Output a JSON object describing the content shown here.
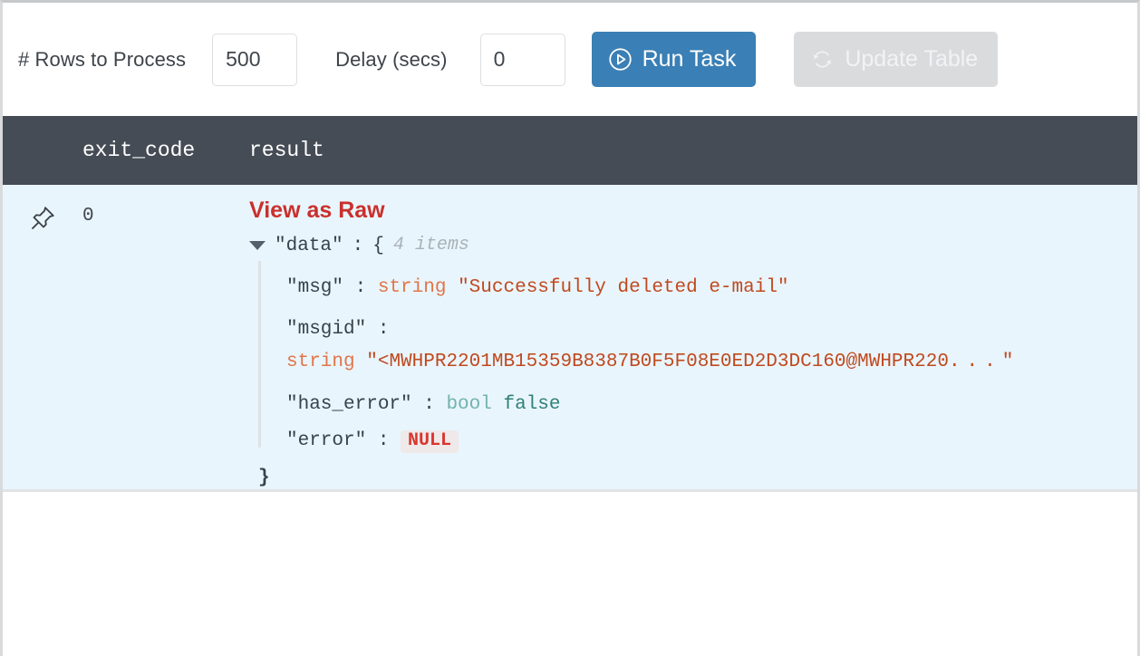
{
  "toolbar": {
    "rows_label": "# Rows to Process",
    "rows_value": "500",
    "rows_placeholder": "",
    "delay_label": "Delay (secs)",
    "delay_value": "0",
    "delay_placeholder": "",
    "run_button": "Run Task",
    "run_icon": "play-circle-icon",
    "update_button": "Update Table",
    "update_icon": "refresh-icon",
    "primary_color": "#3a7fb5",
    "disabled_color": "#d9dbdd"
  },
  "table": {
    "header_background": "#464c55",
    "row_background": "#e9f5fc",
    "columns": [
      {
        "key": "pin",
        "label": ""
      },
      {
        "key": "exit_code",
        "label": "exit_code"
      },
      {
        "key": "result",
        "label": "result"
      }
    ],
    "row": {
      "pin_icon": "pushpin-icon",
      "exit_code": "0",
      "raw_link": "View as Raw"
    }
  },
  "json": {
    "root_key": "\"data\"",
    "root_colon": ":",
    "root_open": "{",
    "root_count": "4 items",
    "close_brace": "}",
    "entries": [
      {
        "key": "\"msg\"",
        "colon": ":",
        "type": "string",
        "value": "\"Successfully deleted e-mail\""
      },
      {
        "key": "\"msgid\"",
        "colon": ":",
        "type": "string",
        "value_open": "\"<MWHPR2201MB15359B8387B0F5F08E0ED2D3DC160@MWHPR220",
        "value_ellipsis": "...",
        "value_close": "\""
      },
      {
        "key": "\"has_error\"",
        "colon": ":",
        "type": "bool",
        "value": "false"
      },
      {
        "key": "\"error\"",
        "colon": ":",
        "value": "NULL"
      }
    ],
    "colors": {
      "key": "#37424c",
      "string_type": "#e0754a",
      "string_value": "#c0491f",
      "bool_type": "#73b3ad",
      "bool_value": "#2f8077",
      "null_value": "#d9362f",
      "count": "#a9b2b9"
    }
  }
}
